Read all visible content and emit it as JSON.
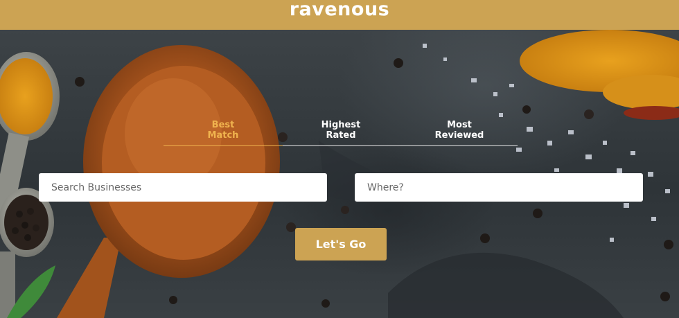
{
  "header": {
    "logo": "ravenous",
    "background_color": "#cca353"
  },
  "sort_tabs": [
    {
      "label_line1": "Best",
      "label_line2": "Match",
      "active": true
    },
    {
      "label_line1": "Highest",
      "label_line2": "Rated",
      "active": false
    },
    {
      "label_line1": "Most",
      "label_line2": "Reviewed",
      "active": false
    }
  ],
  "search": {
    "business_placeholder": "Search Businesses",
    "business_value": "",
    "location_placeholder": "Where?",
    "location_value": ""
  },
  "submit_label": "Let's Go",
  "colors": {
    "accent": "#cca353",
    "active_tab": "#f0b34e",
    "text_light": "#ffffff"
  }
}
